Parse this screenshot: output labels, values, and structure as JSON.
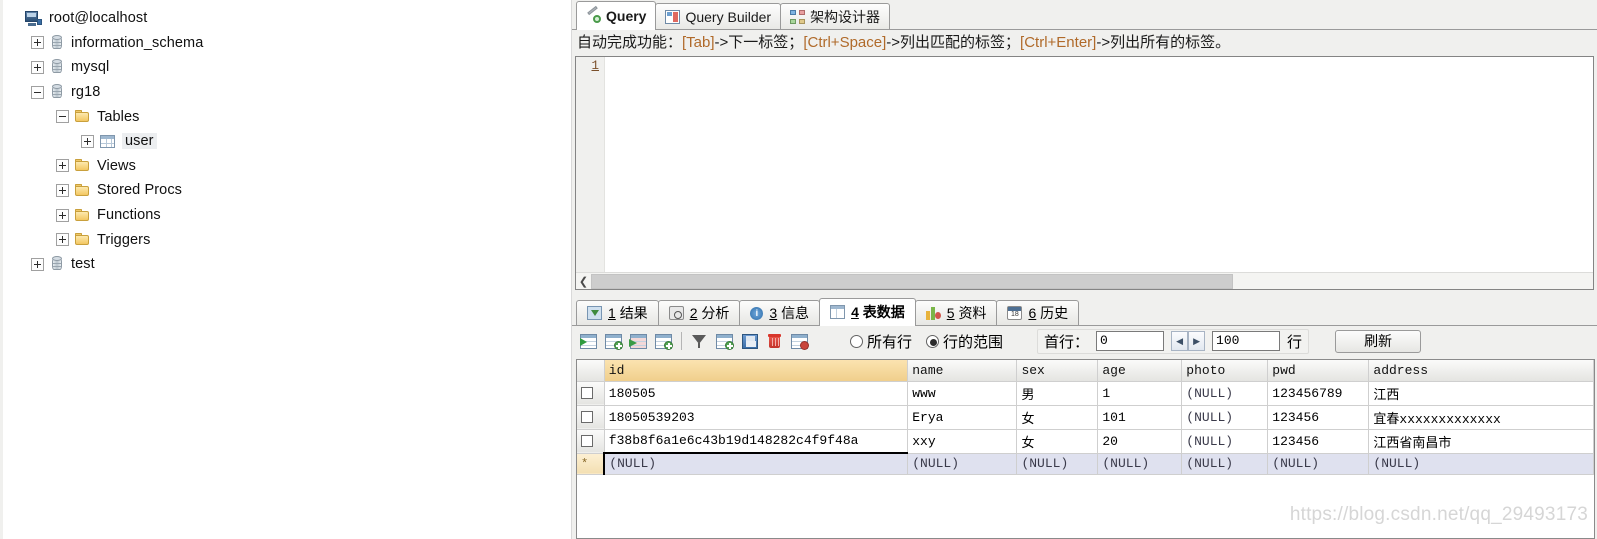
{
  "tree": {
    "items": [
      {
        "label": "root@localhost",
        "icon": "server-icon",
        "indent": 0,
        "expander": "none"
      },
      {
        "label": "information_schema",
        "icon": "database-icon",
        "indent": 1,
        "expander": "plus"
      },
      {
        "label": "mysql",
        "icon": "database-icon",
        "indent": 1,
        "expander": "plus"
      },
      {
        "label": "rg18",
        "icon": "database-icon",
        "indent": 1,
        "expander": "minus"
      },
      {
        "label": "Tables",
        "icon": "folder-icon",
        "indent": 2,
        "expander": "minus"
      },
      {
        "label": "user",
        "icon": "table-icon",
        "indent": 3,
        "expander": "plus",
        "selected": true
      },
      {
        "label": "Views",
        "icon": "folder-icon",
        "indent": 2,
        "expander": "plus"
      },
      {
        "label": "Stored Procs",
        "icon": "folder-icon",
        "indent": 2,
        "expander": "plus"
      },
      {
        "label": "Functions",
        "icon": "folder-icon",
        "indent": 2,
        "expander": "plus"
      },
      {
        "label": "Triggers",
        "icon": "folder-icon",
        "indent": 2,
        "expander": "plus"
      },
      {
        "label": "test",
        "icon": "database-icon",
        "indent": 1,
        "expander": "plus"
      }
    ]
  },
  "top_tabs": [
    {
      "label": "Query",
      "icon": "query-icon",
      "active": true
    },
    {
      "label": "Query Builder",
      "icon": "query-builder-icon",
      "active": false
    },
    {
      "label": "架构设计器",
      "icon": "schema-designer-icon",
      "active": false
    }
  ],
  "hint": {
    "prefix": "自动完成功能：",
    "k1": "[Tab]",
    "t1": "->下一标签；",
    "k2": "[Ctrl+Space]",
    "t2": "->列出匹配的标签；",
    "k3": "[Ctrl+Enter]",
    "t3": "->列出所有的标签。"
  },
  "editor": {
    "line_number": "1",
    "code": ""
  },
  "bottom_tabs": [
    {
      "num": "1",
      "label": "结果",
      "icon": "results-icon",
      "active": false
    },
    {
      "num": "2",
      "label": "分析",
      "icon": "profile-icon",
      "active": false
    },
    {
      "num": "3",
      "label": "信息",
      "icon": "info-icon",
      "active": false
    },
    {
      "num": "4",
      "label": "表数据",
      "icon": "table-data-icon",
      "active": true
    },
    {
      "num": "5",
      "label": "资料",
      "icon": "status-icon",
      "active": false
    },
    {
      "num": "6",
      "label": "历史",
      "icon": "history-icon",
      "active": false
    }
  ],
  "grid_toolbar": {
    "buttons": [
      {
        "name": "new-record-button",
        "icon": "grid-plus-icon"
      },
      {
        "name": "apply-changes-button",
        "icon": "grid-check-icon"
      },
      {
        "name": "export-record-button",
        "icon": "grid-export-icon"
      },
      {
        "name": "duplicate-record-button",
        "icon": "grid-duplicate-icon"
      },
      {
        "name": "filter-button",
        "icon": "funnel-icon"
      },
      {
        "name": "insert-record-button",
        "icon": "grid-insert-icon"
      },
      {
        "name": "save-button",
        "icon": "floppy-disk-icon"
      },
      {
        "name": "delete-record-button",
        "icon": "trash-icon"
      },
      {
        "name": "cancel-changes-button",
        "icon": "grid-cancel-icon"
      }
    ],
    "radio_all_rows": "所有行",
    "radio_row_range": "行的范围",
    "selected_radio": "行的范围",
    "first_row_label": "首行：",
    "first_row_value": "0",
    "count_value": "100",
    "count_unit": "行",
    "refresh_label": "刷新"
  },
  "grid": {
    "columns": [
      "id",
      "name",
      "sex",
      "age",
      "photo",
      "pwd",
      "address"
    ],
    "primary_key": "id",
    "rows": [
      {
        "cells": [
          "180505",
          "www",
          "男",
          "1",
          "(NULL)",
          "123456789",
          "江西"
        ],
        "type": "data"
      },
      {
        "cells": [
          "18050539203",
          "Erya",
          "女",
          "101",
          "(NULL)",
          "123456",
          "宜春xxxxxxxxxxxxx"
        ],
        "type": "data"
      },
      {
        "cells": [
          "f38b8f6a1e6c43b19d148282c4f9f48a",
          "xxy",
          "女",
          "20",
          "(NULL)",
          "123456",
          "江西省南昌市"
        ],
        "type": "data"
      },
      {
        "cells": [
          "(NULL)",
          "(NULL)",
          "(NULL)",
          "(NULL)",
          "(NULL)",
          "(NULL)",
          "(NULL)"
        ],
        "type": "new",
        "marker": "*",
        "editing_cell": 0
      }
    ]
  },
  "watermark": "https://blog.csdn.net/qq_29493173"
}
